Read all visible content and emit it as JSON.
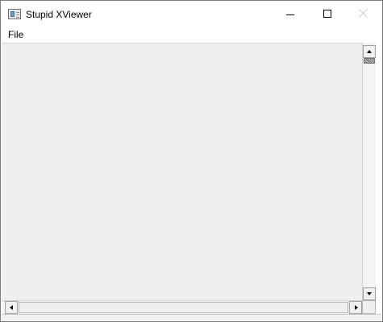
{
  "window": {
    "title": "Stupid XViewer",
    "icon": "app-window-icon"
  },
  "caption_buttons": {
    "minimize": "minimize-icon",
    "maximize": "maximize-icon",
    "close": "close-icon"
  },
  "menu": {
    "items": [
      {
        "label": "File"
      }
    ]
  },
  "scrollbars": {
    "vertical": {
      "up": "arrow-up-icon",
      "down": "arrow-down-icon"
    },
    "horizontal": {
      "left": "arrow-left-icon",
      "right": "arrow-right-icon"
    }
  },
  "colors": {
    "client_bg": "#efefef",
    "titlebar_bg": "#ffffff",
    "close_disabled": "#c8c8c8"
  }
}
